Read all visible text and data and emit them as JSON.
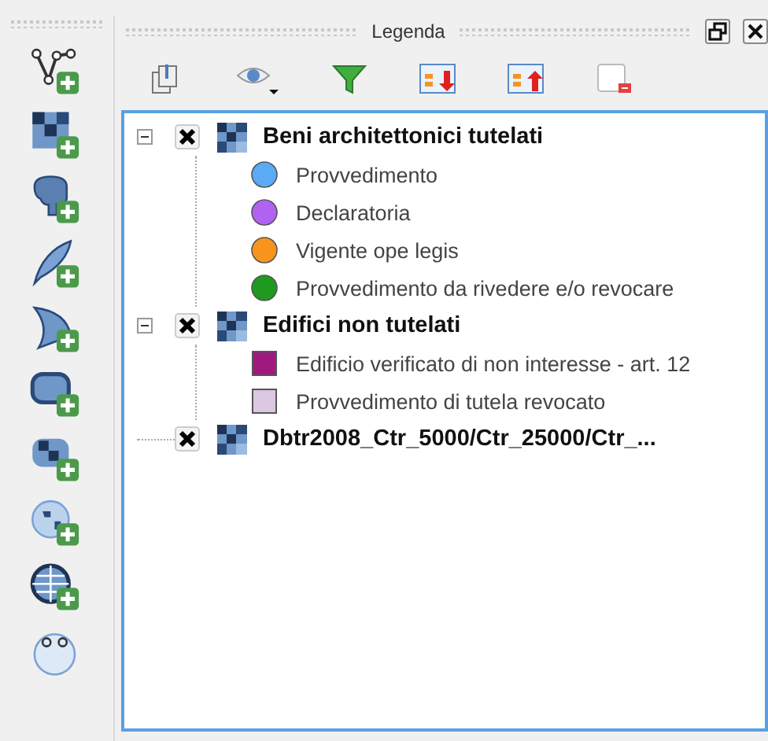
{
  "panel": {
    "title": "Legenda"
  },
  "layers": [
    {
      "name": "Beni architettonici tutelati",
      "checked": true,
      "expanded": true,
      "children": [
        {
          "label": "Provvedimento",
          "kind": "circle",
          "color": "#5aaaf6"
        },
        {
          "label": "Declaratoria",
          "kind": "circle",
          "color": "#b063f0"
        },
        {
          "label": "Vigente ope legis",
          "kind": "circle",
          "color": "#f7941d"
        },
        {
          "label": "Provvedimento da rivedere e/o revocare",
          "kind": "circle",
          "color": "#1e9b1e"
        }
      ]
    },
    {
      "name": "Edifici non tutelati",
      "checked": true,
      "expanded": true,
      "children": [
        {
          "label": "Edificio verificato di non interesse - art. 12",
          "kind": "square",
          "color": "#a0197f"
        },
        {
          "label": "Provvedimento di tutela revocato",
          "kind": "square",
          "color": "#dcc8e0"
        }
      ]
    },
    {
      "name": "Dbtr2008_Ctr_5000/Ctr_25000/Ctr_...",
      "checked": true
    }
  ]
}
